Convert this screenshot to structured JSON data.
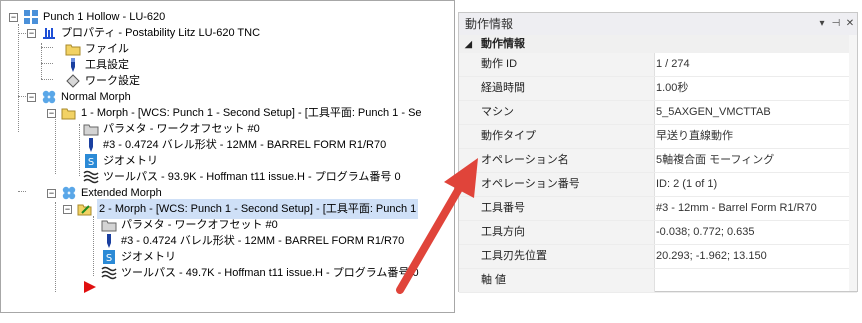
{
  "tree": {
    "root": "Punch 1 Hollow - LU-620",
    "properties": "プロパティ - Postability Litz LU-620 TNC",
    "file": "ファイル",
    "tool_settings": "工具設定",
    "work_settings": "ワーク設定",
    "normal_morph": "Normal Morph",
    "op1": "1 - Morph - [WCS: Punch 1 - Second Setup] - [工具平面: Punch 1 - Se",
    "op1_params": "パラメタ - ワークオフセット #0",
    "op1_tool": "#3 - 0.4724 バレル形状 - 12MM - BARREL FORM R1/R70",
    "op1_geometry": "ジオメトリ",
    "op1_toolpath": "ツールパス - 93.9K - Hoffman t11 issue.H - プログラム番号 0",
    "extended_morph": "Extended Morph",
    "op2": "2 - Morph - [WCS: Punch 1 - Second Setup] - [工具平面: Punch 1",
    "op2_params": "パラメタ - ワークオフセット #0",
    "op2_tool": "#3 - 0.4724 バレル形状 - 12MM - BARREL FORM R1/R70",
    "op2_geometry": "ジオメトリ",
    "op2_toolpath": "ツールパス - 49.7K - Hoffman t11 issue.H - プログラム番号 0"
  },
  "panel": {
    "title": "動作情報",
    "section": "動作情報",
    "rows": [
      {
        "k": "動作 ID",
        "v": "1 / 274"
      },
      {
        "k": "経過時間",
        "v": "1.00秒"
      },
      {
        "k": "マシン",
        "v": "5_5AXGEN_VMCTTAB"
      },
      {
        "k": "動作タイプ",
        "v": "早送り直線動作"
      },
      {
        "k": "オペレーション名",
        "v": "5軸複合面 モーフィング"
      },
      {
        "k": "オペレーション番号",
        "v": "ID: 2 (1 of 1)"
      },
      {
        "k": "工具番号",
        "v": "#3 - 12mm - Barrel Form R1/R70"
      },
      {
        "k": "工具方向",
        "v": "-0.038; 0.772; 0.635"
      },
      {
        "k": "工具刃先位置",
        "v": "20.293; -1.962; 13.150"
      },
      {
        "k": "軸 値",
        "v": ""
      }
    ]
  },
  "colors": {
    "accent_arrow": "#e0443a",
    "selection": "#cfe0f7",
    "folder": "#f2d264"
  }
}
